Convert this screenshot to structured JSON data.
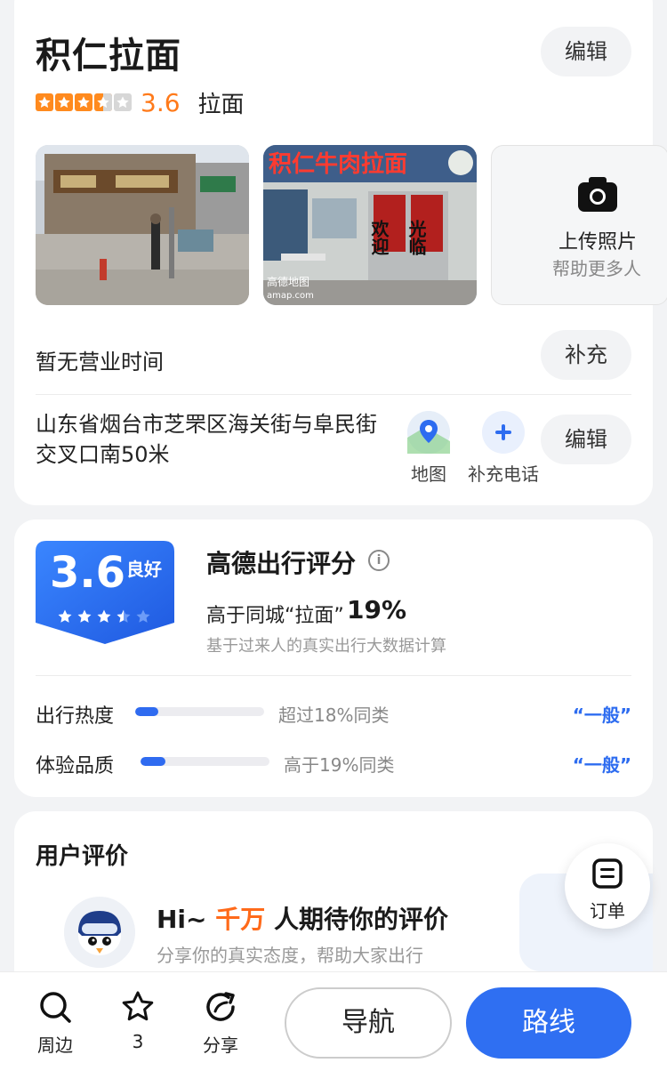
{
  "header": {
    "shop_name": "积仁拉面",
    "edit_label": "编辑",
    "rating_value": 3.6,
    "rating_text": "3.6",
    "category": "拉面",
    "icon_star": "star-icon"
  },
  "photos": {
    "upload_title": "上传照片",
    "upload_subtitle": "帮助更多人",
    "camera_icon": "camera-icon",
    "photo1_watermark": "",
    "photo2_sign": "积仁牛肉拉面",
    "photo2_left_door": "欢迎",
    "photo2_right_door": "光临",
    "photo2_watermark": "高德地图",
    "photo2_watermark_url": "amap.com"
  },
  "hours": {
    "text": "暂无营业时间",
    "supplement_label": "补充"
  },
  "address": {
    "text": "山东省烟台市芝罘区海关街与阜民街交叉口南50米",
    "map_label": "地图",
    "phone_label": "补充电话",
    "edit_label": "编辑"
  },
  "score": {
    "value_text": "3.6",
    "level": "良好",
    "title": "高德出行评分",
    "compare_text": "高于同城“拉面”",
    "compare_pct": "19%",
    "note": "基于过来人的真实出行大数据计算",
    "metrics": [
      {
        "label": "出行热度",
        "text": "超过18%同类",
        "fraction": 0.18,
        "grade": "“一般”"
      },
      {
        "label": "体验品质",
        "text": "高于19%同类",
        "fraction": 0.19,
        "grade": "“一般”"
      }
    ]
  },
  "review": {
    "title": "用户评价",
    "hi_prefix": "Hi~ ",
    "hi_accent": "千万",
    "hi_suffix": " 人期待你的评价",
    "subtitle": "分享你的真实态度，帮助大家出行"
  },
  "order": {
    "label": "订单"
  },
  "bottom": {
    "nearby": "周边",
    "favorite_count": "3",
    "share": "分享",
    "navigate": "导航",
    "route": "路线"
  },
  "colors": {
    "accent_orange": "#ff7a1a",
    "brand_blue": "#2f6ff2",
    "star_gray": "#d7d7d7"
  }
}
